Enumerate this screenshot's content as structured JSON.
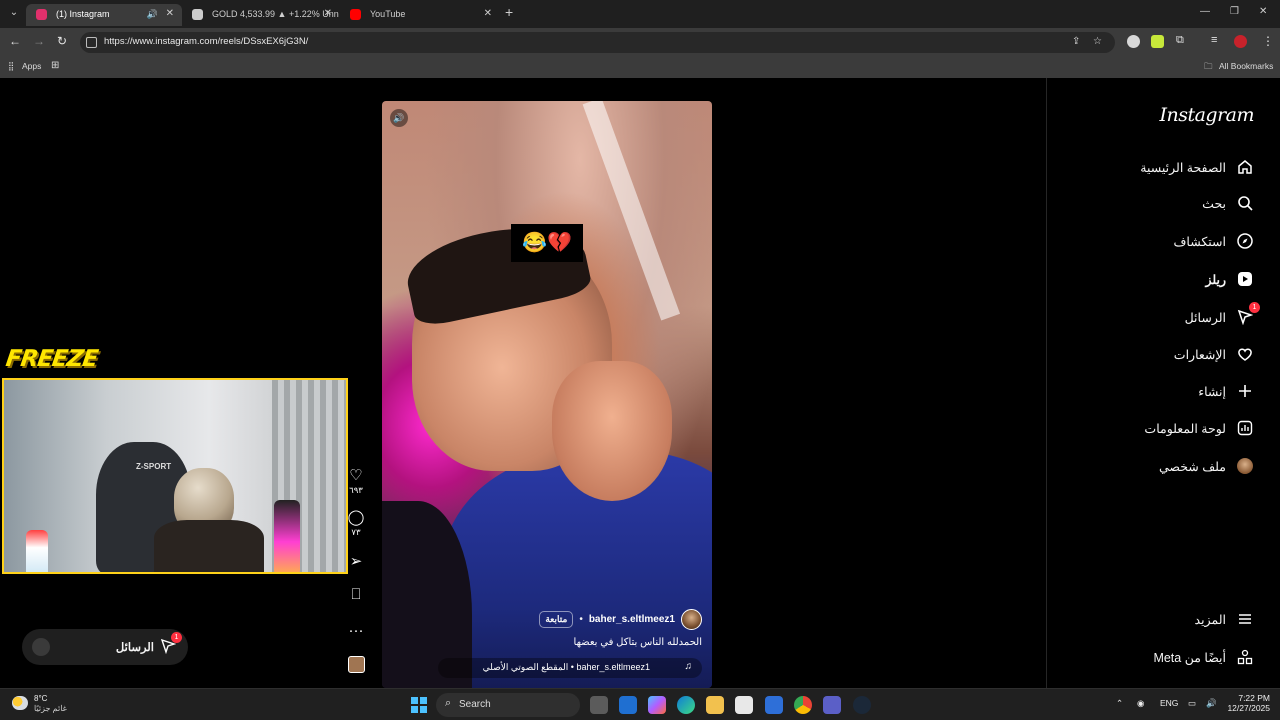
{
  "browser": {
    "tabs": [
      {
        "title": "(1) Instagram",
        "active": true,
        "favicon_color": "#e1306c"
      },
      {
        "title": "GOLD 4,533.99 ▲ +1.22% Unn",
        "active": false,
        "favicon_color": "#cccccc"
      },
      {
        "title": "YouTube",
        "active": false,
        "favicon_color": "#ff0000"
      }
    ],
    "url": "https://www.instagram.com/reels/DSsxEX6jG3N/",
    "bookmarks": {
      "apps": "Apps",
      "all": "All Bookmarks"
    }
  },
  "sidebar": {
    "logo": "Instagram",
    "items": [
      {
        "label": "الصفحة الرئيسية",
        "icon": "home-icon"
      },
      {
        "label": "بحث",
        "icon": "search-icon"
      },
      {
        "label": "استكشاف",
        "icon": "compass-icon"
      },
      {
        "label": "ريلز",
        "icon": "reels-icon"
      },
      {
        "label": "الرسائل",
        "icon": "messages-icon",
        "badge": "1"
      },
      {
        "label": "الإشعارات",
        "icon": "heart-icon"
      },
      {
        "label": "إنشاء",
        "icon": "plus-icon"
      },
      {
        "label": "لوحة المعلومات",
        "icon": "dashboard-icon"
      },
      {
        "label": "ملف شخصي",
        "icon": "profile-avatar"
      }
    ],
    "more": "المزيد",
    "meta": "أيضًا من Meta"
  },
  "reel": {
    "emoji_overlay": "😂💔",
    "username": "baher_s.eltlmeez1",
    "follow_label": "متابعة",
    "caption": "الحمدلله الناس بتاكل في بعضها",
    "audio": "baher_s.eltlmeez1 • المقطع الصوتي الأصلي"
  },
  "actions": {
    "likes": "٦٩٣",
    "comments": "٧٣"
  },
  "overlay": {
    "brand": "FREEZE",
    "chair_label": "Z-SPORT",
    "messages_pill": {
      "label": "الرسائل",
      "badge": "1"
    }
  },
  "taskbar": {
    "weather_temp": "8°C",
    "weather_desc": "غائم جزئيًا",
    "search_label": "Search",
    "language": "ENG",
    "time": "7:22 PM",
    "date": "12/27/2025"
  },
  "colors": {
    "accent": "#ff3040",
    "cam_border": "#ffd21a",
    "brand_yellow": "#ffe600"
  }
}
